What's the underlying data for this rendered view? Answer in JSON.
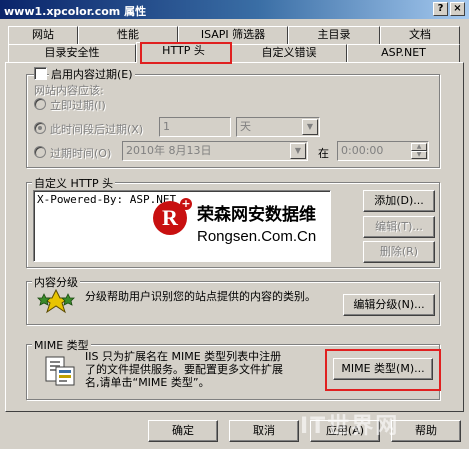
{
  "window": {
    "title": "www1.xpcolor.com 属性",
    "help_btn": "?",
    "close_btn": "×"
  },
  "tabs_row1": [
    "网站",
    "性能",
    "ISAPI 筛选器",
    "主目录",
    "文档"
  ],
  "tabs_row2": [
    "目录安全性",
    "HTTP 头",
    "自定义错误",
    "ASP.NET"
  ],
  "expire": {
    "enable_label": "启用内容过期(E)",
    "group_label": "网站内容应该:",
    "immediate": "立即过期(I)",
    "after": "此时间段后过期(X)",
    "after_value": "1",
    "after_unit": "天",
    "on": "过期时间(O)",
    "date": "2010年 8月13日",
    "at": "在",
    "time": "0:00:00"
  },
  "custom_headers": {
    "label": "自定义 HTTP 头",
    "items": [
      "X-Powered-By: ASP.NET"
    ],
    "add": "添加(D)...",
    "edit": "编辑(T)...",
    "delete": "删除(R)"
  },
  "watermark": {
    "logo_letter": "R",
    "cn": "荣森网安数据维",
    "en": "Rongsen.Com.Cn"
  },
  "ratings": {
    "label": "内容分级",
    "desc": "分级帮助用户识别您的站点提供的内容的类别。",
    "edit": "编辑分级(N)..."
  },
  "mime": {
    "label": "MIME 类型",
    "desc1": "IIS 只为扩展名在 MIME 类型列表中注册",
    "desc2": "了的文件提供服务。要配置更多文件扩展",
    "desc3": "名,请单击“MIME 类型”。",
    "button": "MIME 类型(M)..."
  },
  "footer": {
    "ok": "确定",
    "cancel": "取消",
    "apply": "应用(A)",
    "help": "帮助"
  },
  "corner_watermark": "IT世界网"
}
